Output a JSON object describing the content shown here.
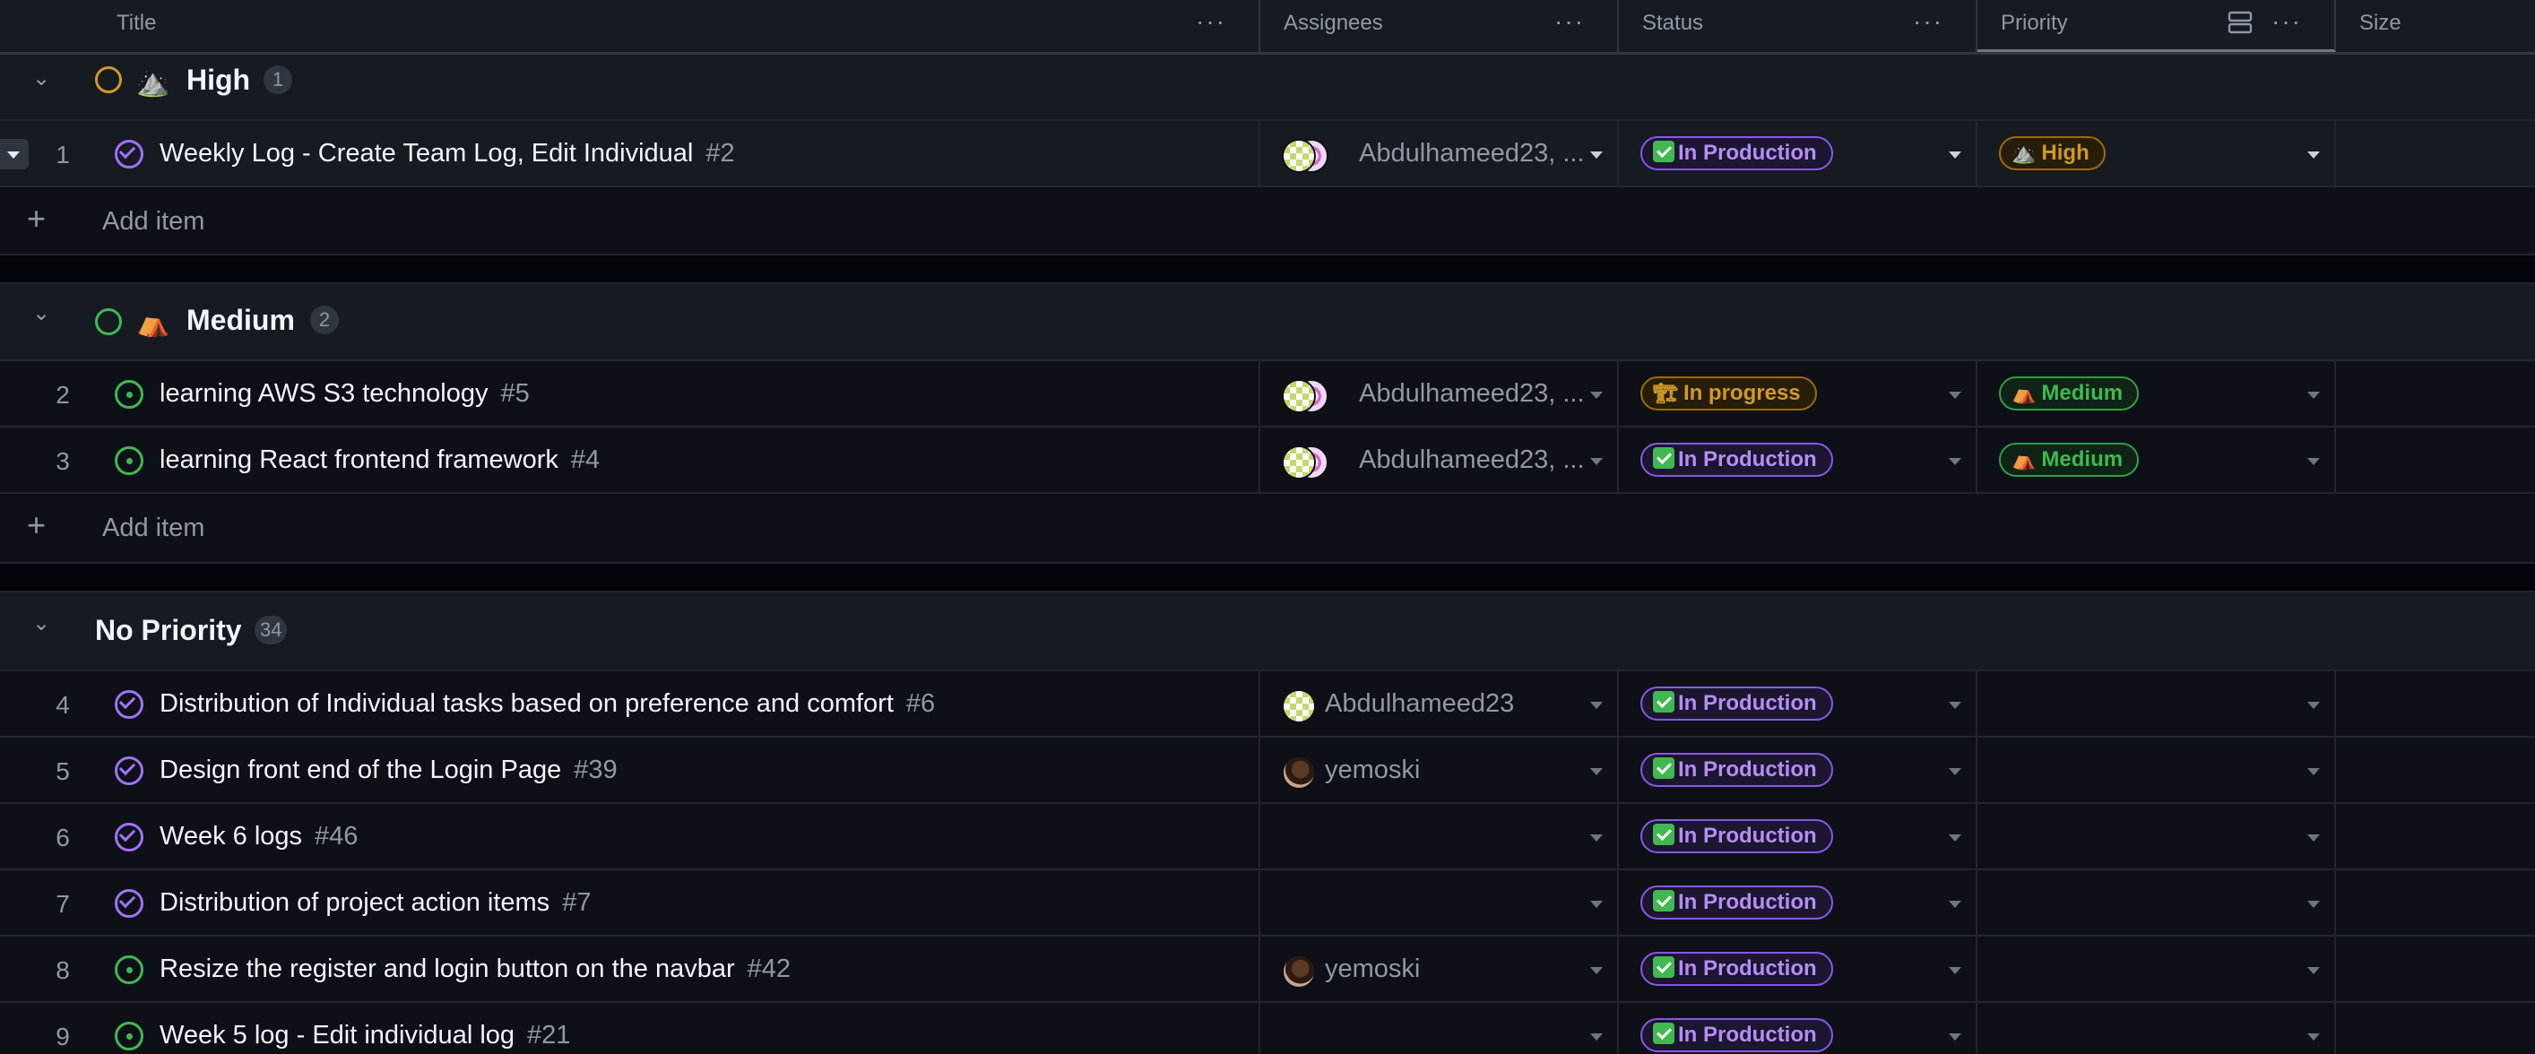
{
  "columns": {
    "title": "Title",
    "assignees": "Assignees",
    "status": "Status",
    "priority": "Priority",
    "size": "Size",
    "more_icon": "kebab-horizontal-icon",
    "group_icon": "rows-icon"
  },
  "groups": [
    {
      "name": "High",
      "emoji": "⛰️",
      "count": "1",
      "add_label": "Add item"
    },
    {
      "name": "Medium",
      "emoji": "⛺",
      "count": "2",
      "add_label": "Add item"
    },
    {
      "name": "No Priority",
      "emoji": "",
      "count": "34"
    }
  ],
  "rows": [
    {
      "num": "1",
      "title": "Weekly Log - Create Team Log, Edit Individual",
      "issue": "#2",
      "state": "closed",
      "assignees": "Abdulhameed23, ...",
      "avatars": [
        "green",
        "pink"
      ],
      "status": "In Production",
      "status_icon": "check-box-icon",
      "priority": "High",
      "priority_emoji": "⛰️"
    },
    {
      "num": "2",
      "title": "learning AWS S3 technology",
      "issue": "#5",
      "state": "open",
      "assignees": "Abdulhameed23, ...",
      "avatars": [
        "green",
        "pink"
      ],
      "status": "In progress",
      "status_icon": "construction-icon",
      "priority": "Medium",
      "priority_emoji": "⛺"
    },
    {
      "num": "3",
      "title": "learning React frontend framework",
      "issue": "#4",
      "state": "open",
      "assignees": "Abdulhameed23, ...",
      "avatars": [
        "green",
        "pink"
      ],
      "status": "In Production",
      "status_icon": "check-box-icon",
      "priority": "Medium",
      "priority_emoji": "⛺"
    },
    {
      "num": "4",
      "title": "Distribution of Individual tasks based on preference and comfort",
      "issue": "#6",
      "state": "closed",
      "assignees": "Abdulhameed23",
      "avatars": [
        "green"
      ],
      "status": "In Production",
      "status_icon": "check-box-icon",
      "priority": "",
      "priority_emoji": ""
    },
    {
      "num": "5",
      "title": "Design front end of the Login Page",
      "issue": "#39",
      "state": "closed",
      "assignees": "yemoski",
      "avatars": [
        "brown"
      ],
      "status": "In Production",
      "status_icon": "check-box-icon",
      "priority": "",
      "priority_emoji": ""
    },
    {
      "num": "6",
      "title": "Week 6 logs",
      "issue": "#46",
      "state": "closed",
      "assignees": "",
      "avatars": [],
      "status": "In Production",
      "status_icon": "check-box-icon",
      "priority": "",
      "priority_emoji": ""
    },
    {
      "num": "7",
      "title": "Distribution of project action items",
      "issue": "#7",
      "state": "closed",
      "assignees": "",
      "avatars": [],
      "status": "In Production",
      "status_icon": "check-box-icon",
      "priority": "",
      "priority_emoji": ""
    },
    {
      "num": "8",
      "title": "Resize the register and login button on the navbar",
      "issue": "#42",
      "state": "open",
      "assignees": "yemoski",
      "avatars": [
        "brown"
      ],
      "status": "In Production",
      "status_icon": "check-box-icon",
      "priority": "",
      "priority_emoji": ""
    },
    {
      "num": "9",
      "title": "Week 5 log - Edit individual log",
      "issue": "#21",
      "state": "open",
      "assignees": "",
      "avatars": [],
      "status": "In Production",
      "status_icon": "check-box-icon",
      "priority": "",
      "priority_emoji": ""
    }
  ],
  "colors": {
    "background": "#0d1117",
    "header": "#161b22",
    "closed_purple": "#a371f7",
    "open_green": "#3fb950",
    "high_orange": "#d29922"
  }
}
